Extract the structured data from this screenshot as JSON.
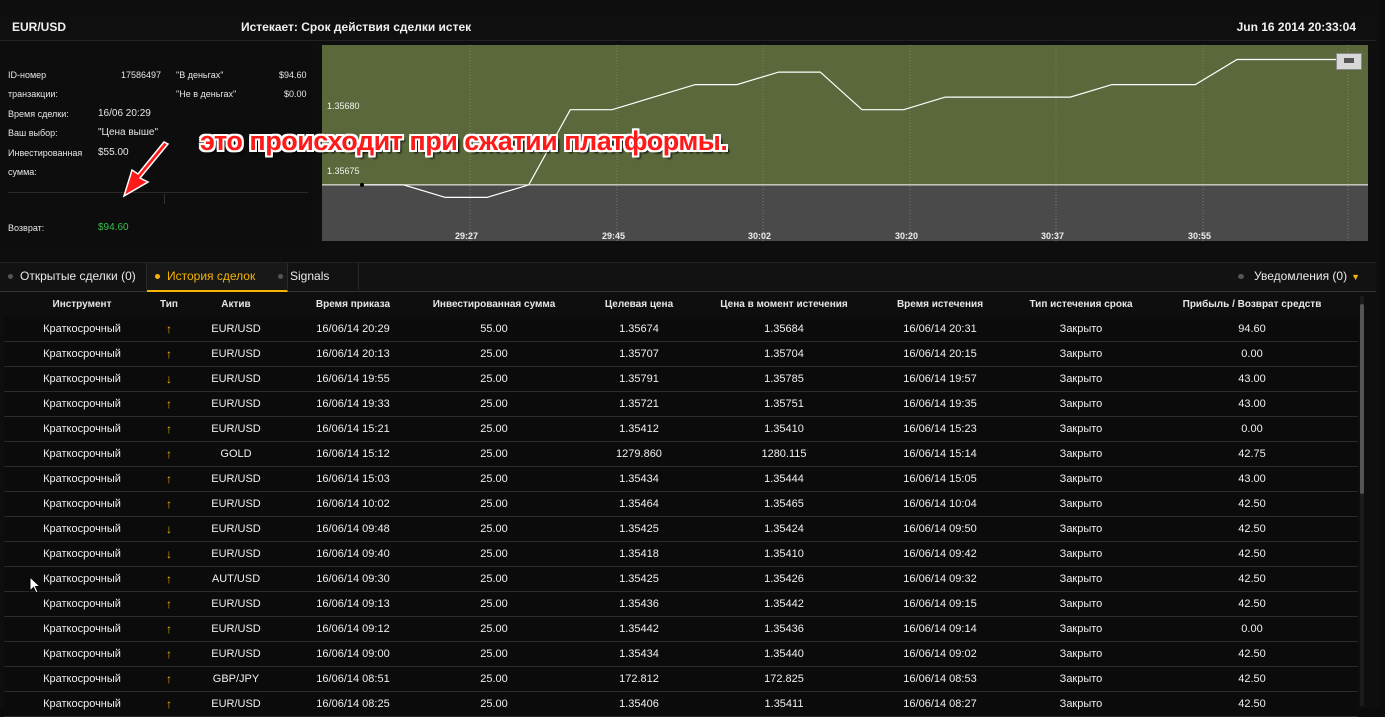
{
  "header": {
    "pair": "EUR/USD",
    "expiry_text": "Истекает:  Срок действия сделки истек",
    "datetime": "Jun 16 2014  20:33:04"
  },
  "info": {
    "id_label": "ID-номер",
    "id_label2": "транзакции:",
    "id_value": "17586497",
    "in_money_label": "\"В деньгах\"",
    "in_money_value": "$94.60",
    "out_money_label": "\"Не в деньгах\"",
    "out_money_value": "$0.00",
    "time_label": "Время сделки:",
    "time_value": "16/06 20:29",
    "choice_label": "Ваш выбор:",
    "choice_value": "\"Цена выше\"",
    "invested_label": "Инвестированная",
    "invested_label2": "сумма:",
    "invested_value": "$55.00",
    "return_label": "Возврат:",
    "return_value": "$94.60"
  },
  "annotation": "это происходит при сжатии платформы.",
  "chart_data": {
    "type": "line",
    "price_labels": [
      "1.35680",
      "1.35675"
    ],
    "x_ticks": [
      "29:27",
      "29:45",
      "30:02",
      "30:20",
      "30:37",
      "30:55"
    ],
    "target_price": 1.35674,
    "ylim": [
      1.3567,
      1.35685
    ],
    "series": [
      {
        "values": [
          1.35674,
          1.35674,
          1.35673,
          1.35673,
          1.35674,
          1.3568,
          1.3568,
          1.35681,
          1.35682,
          1.35682,
          1.35683,
          1.35683,
          1.3568,
          1.3568,
          1.35681,
          1.35681,
          1.35681,
          1.35681,
          1.35682,
          1.35682,
          1.35682,
          1.35684,
          1.35684,
          1.35684,
          1.35684
        ]
      }
    ],
    "colors": {
      "above": "#5b683b",
      "below": "#4a4a4a",
      "line": "#ffffff"
    }
  },
  "tabs": [
    {
      "label": "Открытые сделки (0)",
      "active": false
    },
    {
      "label": "История сделок",
      "active": true
    },
    {
      "label": "Signals",
      "active": false
    }
  ],
  "notifications": "Уведомления (0)",
  "columns": [
    "Инструмент",
    "Тип",
    "Актив",
    "Время приказа",
    "Инвестированная сумма",
    "Целевая цена",
    "Цена в момент истечения",
    "Время истечения",
    "Тип истечения срока",
    "Прибыль / Возврат средств"
  ],
  "rows": [
    [
      "Краткосрочный",
      "↑",
      "EUR/USD",
      "16/06/14 20:29",
      "55.00",
      "1.35674",
      "1.35684",
      "16/06/14 20:31",
      "Закрыто",
      "94.60"
    ],
    [
      "Краткосрочный",
      "↑",
      "EUR/USD",
      "16/06/14 20:13",
      "25.00",
      "1.35707",
      "1.35704",
      "16/06/14 20:15",
      "Закрыто",
      "0.00"
    ],
    [
      "Краткосрочный",
      "↓",
      "EUR/USD",
      "16/06/14 19:55",
      "25.00",
      "1.35791",
      "1.35785",
      "16/06/14 19:57",
      "Закрыто",
      "43.00"
    ],
    [
      "Краткосрочный",
      "↑",
      "EUR/USD",
      "16/06/14 19:33",
      "25.00",
      "1.35721",
      "1.35751",
      "16/06/14 19:35",
      "Закрыто",
      "43.00"
    ],
    [
      "Краткосрочный",
      "↑",
      "EUR/USD",
      "16/06/14 15:21",
      "25.00",
      "1.35412",
      "1.35410",
      "16/06/14 15:23",
      "Закрыто",
      "0.00"
    ],
    [
      "Краткосрочный",
      "↑",
      "GOLD",
      "16/06/14 15:12",
      "25.00",
      "1279.860",
      "1280.115",
      "16/06/14 15:14",
      "Закрыто",
      "42.75"
    ],
    [
      "Краткосрочный",
      "↑",
      "EUR/USD",
      "16/06/14 15:03",
      "25.00",
      "1.35434",
      "1.35444",
      "16/06/14 15:05",
      "Закрыто",
      "43.00"
    ],
    [
      "Краткосрочный",
      "↑",
      "EUR/USD",
      "16/06/14 10:02",
      "25.00",
      "1.35464",
      "1.35465",
      "16/06/14 10:04",
      "Закрыто",
      "42.50"
    ],
    [
      "Краткосрочный",
      "↓",
      "EUR/USD",
      "16/06/14 09:48",
      "25.00",
      "1.35425",
      "1.35424",
      "16/06/14 09:50",
      "Закрыто",
      "42.50"
    ],
    [
      "Краткосрочный",
      "↓",
      "EUR/USD",
      "16/06/14 09:40",
      "25.00",
      "1.35418",
      "1.35410",
      "16/06/14 09:42",
      "Закрыто",
      "42.50"
    ],
    [
      "Краткосрочный",
      "↑",
      "AUT/USD",
      "16/06/14 09:30",
      "25.00",
      "1.35425",
      "1.35426",
      "16/06/14 09:32",
      "Закрыто",
      "42.50"
    ],
    [
      "Краткосрочный",
      "↑",
      "EUR/USD",
      "16/06/14 09:13",
      "25.00",
      "1.35436",
      "1.35442",
      "16/06/14 09:15",
      "Закрыто",
      "42.50"
    ],
    [
      "Краткосрочный",
      "↑",
      "EUR/USD",
      "16/06/14 09:12",
      "25.00",
      "1.35442",
      "1.35436",
      "16/06/14 09:14",
      "Закрыто",
      "0.00"
    ],
    [
      "Краткосрочный",
      "↑",
      "EUR/USD",
      "16/06/14 09:00",
      "25.00",
      "1.35434",
      "1.35440",
      "16/06/14 09:02",
      "Закрыто",
      "42.50"
    ],
    [
      "Краткосрочный",
      "↑",
      "GBP/JPY",
      "16/06/14 08:51",
      "25.00",
      "172.812",
      "172.825",
      "16/06/14 08:53",
      "Закрыто",
      "42.50"
    ],
    [
      "Краткосрочный",
      "↑",
      "EUR/USD",
      "16/06/14 08:25",
      "25.00",
      "1.35406",
      "1.35411",
      "16/06/14 08:27",
      "Закрыто",
      "42.50"
    ]
  ]
}
